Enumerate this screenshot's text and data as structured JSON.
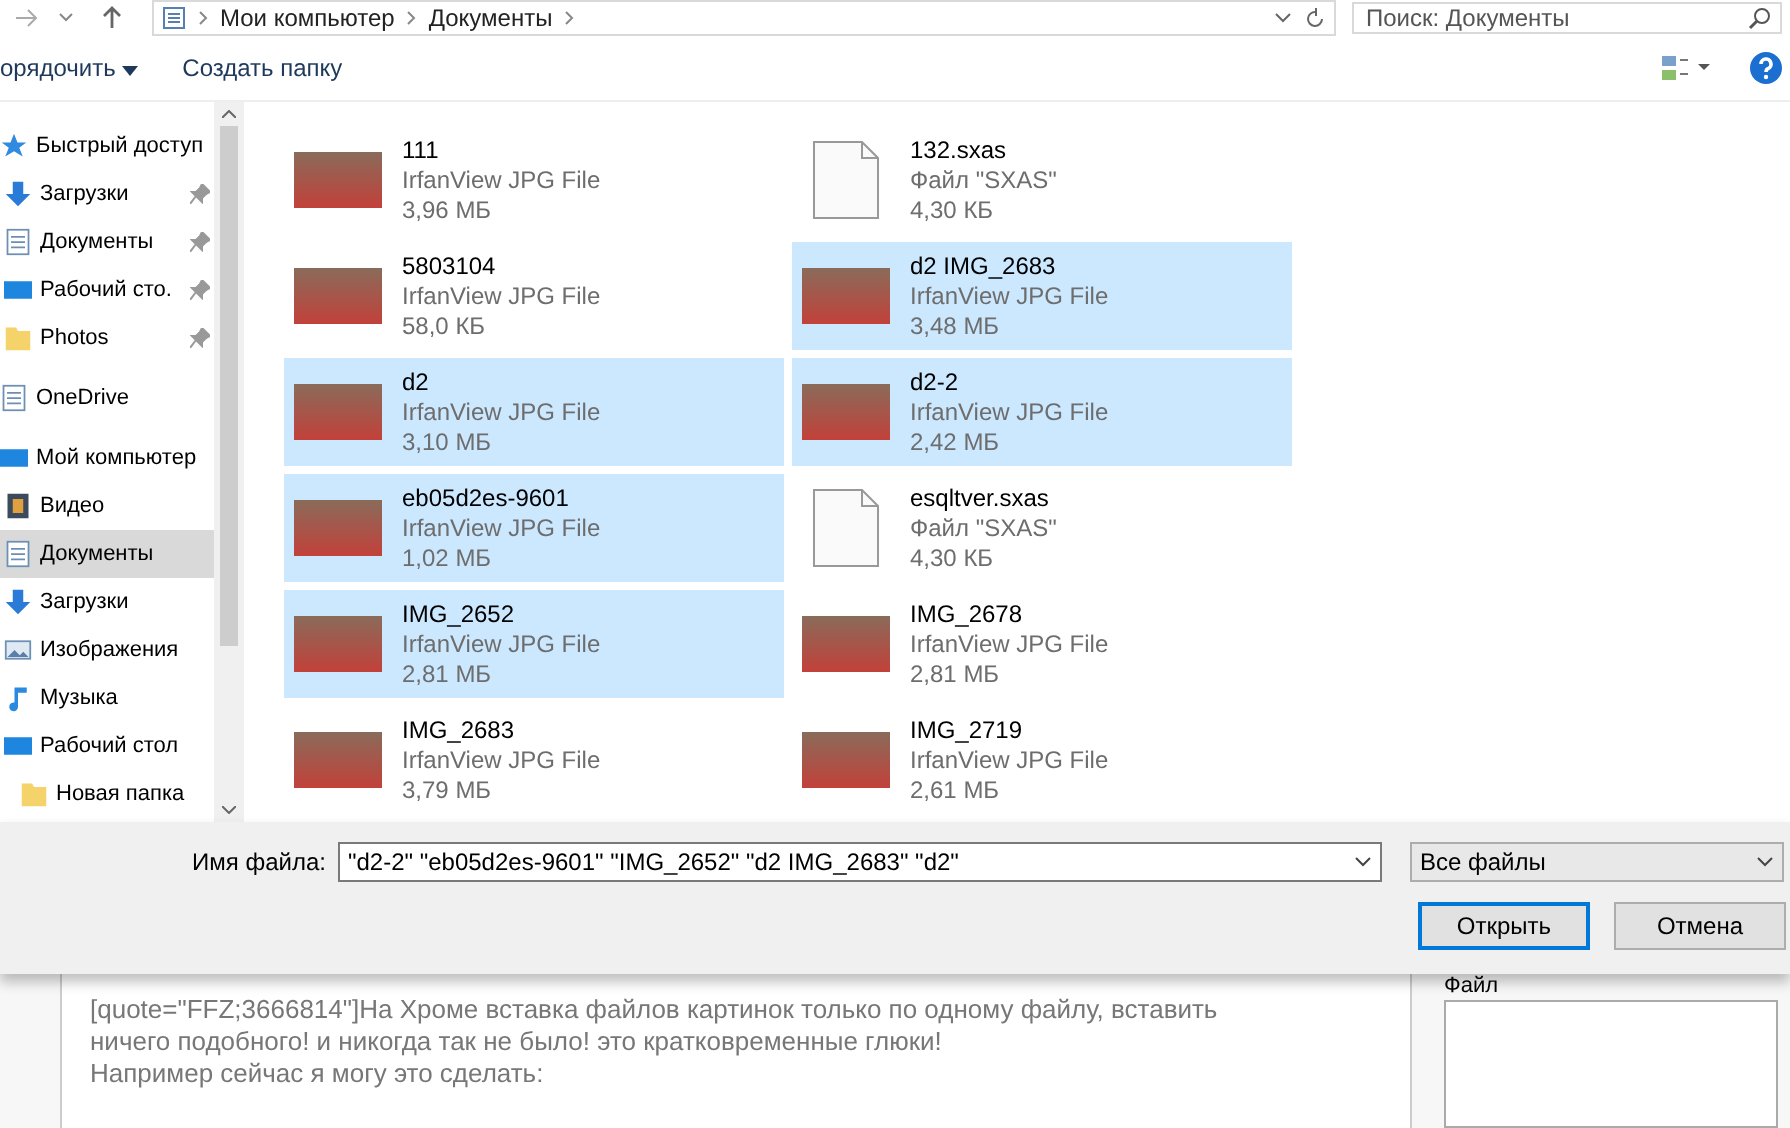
{
  "address_bar": {
    "path": [
      "Мои компьютер",
      "Документы"
    ],
    "search": {
      "placeholder": "Поиск: Документы"
    }
  },
  "toolbar": {
    "organize": "орядочить",
    "new_folder": "Создать папку"
  },
  "sidebar": {
    "items": [
      {
        "label": "Быстрый доступ",
        "kind": "star",
        "selected": false,
        "children": [
          {
            "label": "Загрузки",
            "kind": "download",
            "pinned": true,
            "selected": false
          },
          {
            "label": "Документы",
            "kind": "document",
            "pinned": true,
            "selected": false
          },
          {
            "label": "Рабочий сто.",
            "kind": "desktop",
            "pinned": true,
            "selected": false
          },
          {
            "label": "Photos",
            "kind": "folder",
            "pinned": true,
            "selected": false
          }
        ]
      },
      {
        "label": "OneDrive",
        "kind": "document",
        "selected": false
      },
      {
        "label": "Мой компьютер",
        "kind": "desktop",
        "selected": false,
        "children": [
          {
            "label": "Видео",
            "kind": "video",
            "selected": false
          },
          {
            "label": "Документы",
            "kind": "document",
            "selected": true
          },
          {
            "label": "Загрузки",
            "kind": "download",
            "selected": false
          },
          {
            "label": "Изображения",
            "kind": "image",
            "selected": false
          },
          {
            "label": "Музыка",
            "kind": "music",
            "selected": false
          },
          {
            "label": "Рабочий стол",
            "kind": "desktop",
            "selected": false,
            "children": [
              {
                "label": "Новая папка",
                "kind": "folder",
                "selected": false
              }
            ]
          }
        ]
      }
    ]
  },
  "files": [
    {
      "name": "111",
      "type": "IrfanView JPG File",
      "size": "3,96 МБ",
      "kind": "image",
      "selected": false
    },
    {
      "name": "132.sxas",
      "type": "Файл \"SXAS\"",
      "size": "4,30 КБ",
      "kind": "document",
      "selected": false
    },
    {
      "name": "5803104",
      "type": "IrfanView JPG File",
      "size": "58,0 КБ",
      "kind": "image",
      "selected": false
    },
    {
      "name": "d2 IMG_2683",
      "type": "IrfanView JPG File",
      "size": "3,48 МБ",
      "kind": "image",
      "selected": true
    },
    {
      "name": "d2",
      "type": "IrfanView JPG File",
      "size": "3,10 МБ",
      "kind": "image",
      "selected": true
    },
    {
      "name": "d2-2",
      "type": "IrfanView JPG File",
      "size": "2,42 МБ",
      "kind": "image",
      "selected": true
    },
    {
      "name": "eb05d2es-9601",
      "type": "IrfanView JPG File",
      "size": "1,02 МБ",
      "kind": "image",
      "selected": true
    },
    {
      "name": "esqltver.sxas",
      "type": "Файл \"SXAS\"",
      "size": "4,30 КБ",
      "kind": "document",
      "selected": false
    },
    {
      "name": "IMG_2652",
      "type": "IrfanView JPG File",
      "size": "2,81 МБ",
      "kind": "image",
      "selected": true
    },
    {
      "name": "IMG_2678",
      "type": "IrfanView JPG File",
      "size": "2,81 МБ",
      "kind": "image",
      "selected": false
    },
    {
      "name": "IMG_2683",
      "type": "IrfanView JPG File",
      "size": "3,79 МБ",
      "kind": "image",
      "selected": false
    },
    {
      "name": "IMG_2719",
      "type": "IrfanView JPG File",
      "size": "2,61 МБ",
      "kind": "image",
      "selected": false
    }
  ],
  "footer": {
    "filename_label": "Имя файла:",
    "filename": "\"d2-2\" \"eb05d2es-9601\" \"IMG_2652\" \"d2 IMG_2683\" \"d2\"",
    "filter": "Все файлы",
    "open": "Открыть",
    "cancel": "Отмена"
  },
  "background_page": {
    "message": [
      "[quote=\"FFZ;3666814\"]На Хроме вставка файлов картинок только по одному файлу, вставить",
      "ничего подобного! и никогда так не было! это кратковременные глюки!",
      "Например сейчас я могу это сделать:"
    ],
    "side_label": "Файл"
  }
}
